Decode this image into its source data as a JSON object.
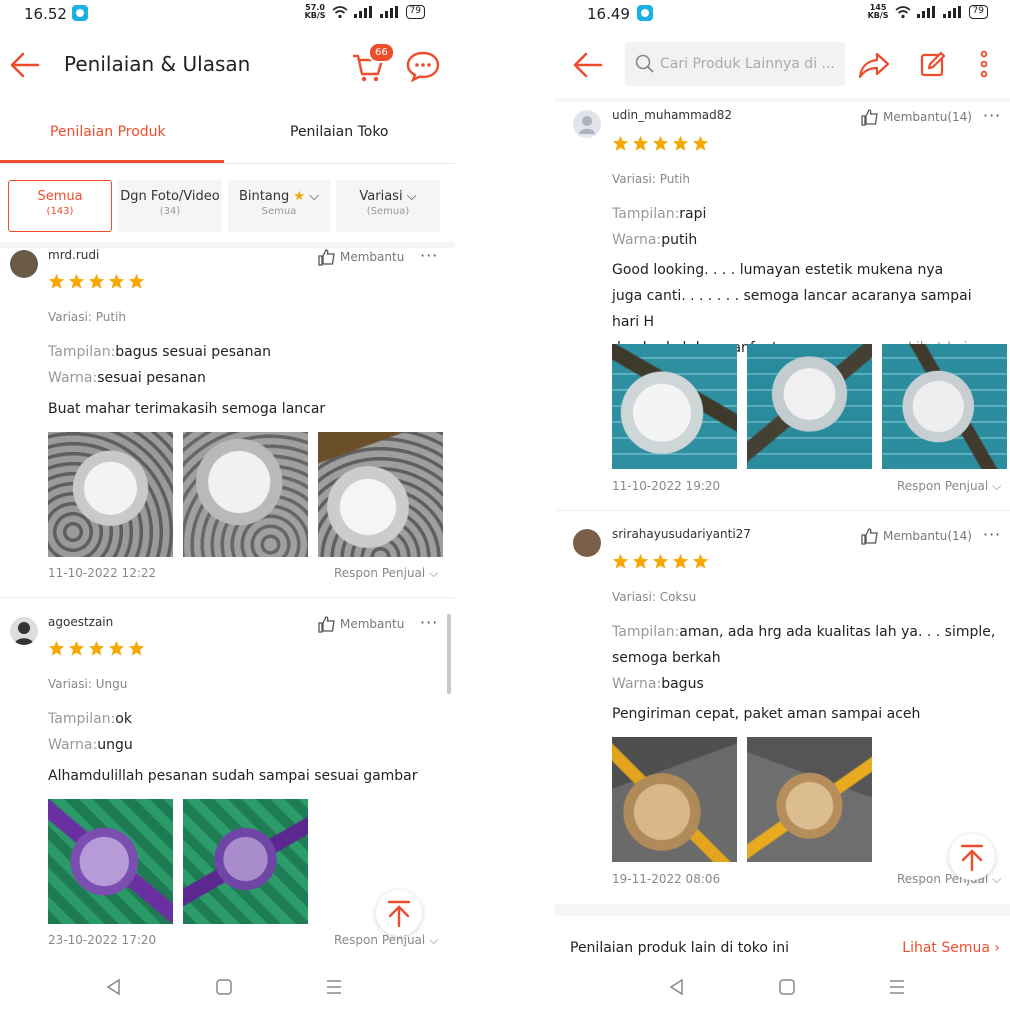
{
  "colors": {
    "accent": "#ee4d2d",
    "star": "#f6a700"
  },
  "left": {
    "status": {
      "time": "16.52",
      "speed_top": "57.0",
      "speed_bottom": "KB/S",
      "battery": "79"
    },
    "header": {
      "title": "Penilaian & Ulasan",
      "cart_badge": "66"
    },
    "tabs": [
      {
        "label": "Penilaian Produk"
      },
      {
        "label": "Penilaian Toko"
      }
    ],
    "filters": [
      {
        "label": "Semua",
        "sub": "(143)"
      },
      {
        "label": "Dgn Foto/Video",
        "sub": "(34)"
      },
      {
        "label": "Bintang",
        "sub": "Semua"
      },
      {
        "label": "Variasi",
        "sub": "(Semua)"
      }
    ],
    "reviews": [
      {
        "user": "mrd.rudi",
        "helpful": "Membantu",
        "rating": 5,
        "variasi": "Variasi: Putih",
        "tampilan_key": "Tampilan:",
        "tampilan_val": "bagus sesuai pesanan",
        "warna_key": "Warna:",
        "warna_val": "sesuai pesanan",
        "text": "Buat mahar terimakasih semoga lancar",
        "date": "11-10-2022 12:22",
        "respon": "Respon Penjual"
      },
      {
        "user": "agoestzain",
        "helpful": "Membantu",
        "rating": 5,
        "variasi": "Variasi: Ungu",
        "tampilan_key": "Tampilan:",
        "tampilan_val": "ok",
        "warna_key": "Warna:",
        "warna_val": "ungu",
        "text": "Alhamdulillah pesanan sudah sampai sesuai gambar",
        "date": "23-10-2022 17:20",
        "respon": "Respon Penjual"
      }
    ]
  },
  "right": {
    "status": {
      "time": "16.49",
      "speed_top": "145",
      "speed_bottom": "KB/S",
      "battery": "79"
    },
    "search": {
      "placeholder": "Cari Produk Lainnya di ..."
    },
    "reviews": [
      {
        "user": "udin_muhammad82",
        "helpful": "Membantu(14)",
        "rating": 5,
        "variasi": "Variasi: Putih",
        "tampilan_key": "Tampilan:",
        "tampilan_val": "rapi",
        "warna_key": "Warna:",
        "warna_val": "putih",
        "text_l1": "Good looking. . . . lumayan estetik mukena nya",
        "text_l2": "juga canti. . . . . . . semoga lancar acaranya sampai hari H",
        "text_l3": "dan berkah bermanfaat.",
        "lihat": "Lihat Lainnya",
        "date": "11-10-2022 19:20",
        "respon": "Respon Penjual"
      },
      {
        "user": "srirahayusudariyanti27",
        "helpful": "Membantu(14)",
        "rating": 5,
        "variasi": "Variasi: Coksu",
        "tampilan_key": "Tampilan:",
        "tampilan_val": "aman,  ada hrg ada kualitas lah ya. . .  simple,",
        "tampilan_val2": "semoga berkah",
        "warna_key": "Warna:",
        "warna_val": "bagus",
        "text": "Pengiriman cepat,  paket aman sampai aceh",
        "date": "19-11-2022 08:06",
        "respon": "Respon Penjual"
      }
    ],
    "footer": {
      "label": "Penilaian produk lain di toko ini",
      "link": "Lihat Semua"
    }
  }
}
